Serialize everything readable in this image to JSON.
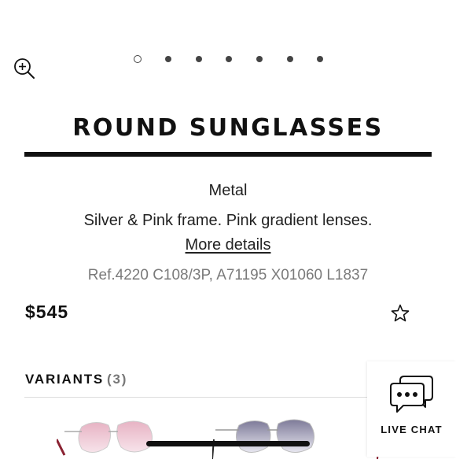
{
  "carousel": {
    "total": 7,
    "active_index": 0
  },
  "product": {
    "title": "ROUND SUNGLASSES",
    "material": "Metal",
    "description": "Silver & Pink frame. Pink gradient lenses.",
    "more_details": "More details",
    "reference": "Ref.4220 C108/3P, A71195 X01060 L1837",
    "price": "$545"
  },
  "variants": {
    "label": "VARIANTS",
    "count": "(3)"
  },
  "live_chat": {
    "label": "LIVE CHAT"
  },
  "colors": {
    "text": "#111111",
    "muted": "#7a7a7a",
    "pink_lens": "#d98fa6",
    "grey_lens": "#8a88a6"
  },
  "icons": [
    "zoom-in-icon",
    "star-icon",
    "chat-bubble-icon"
  ]
}
